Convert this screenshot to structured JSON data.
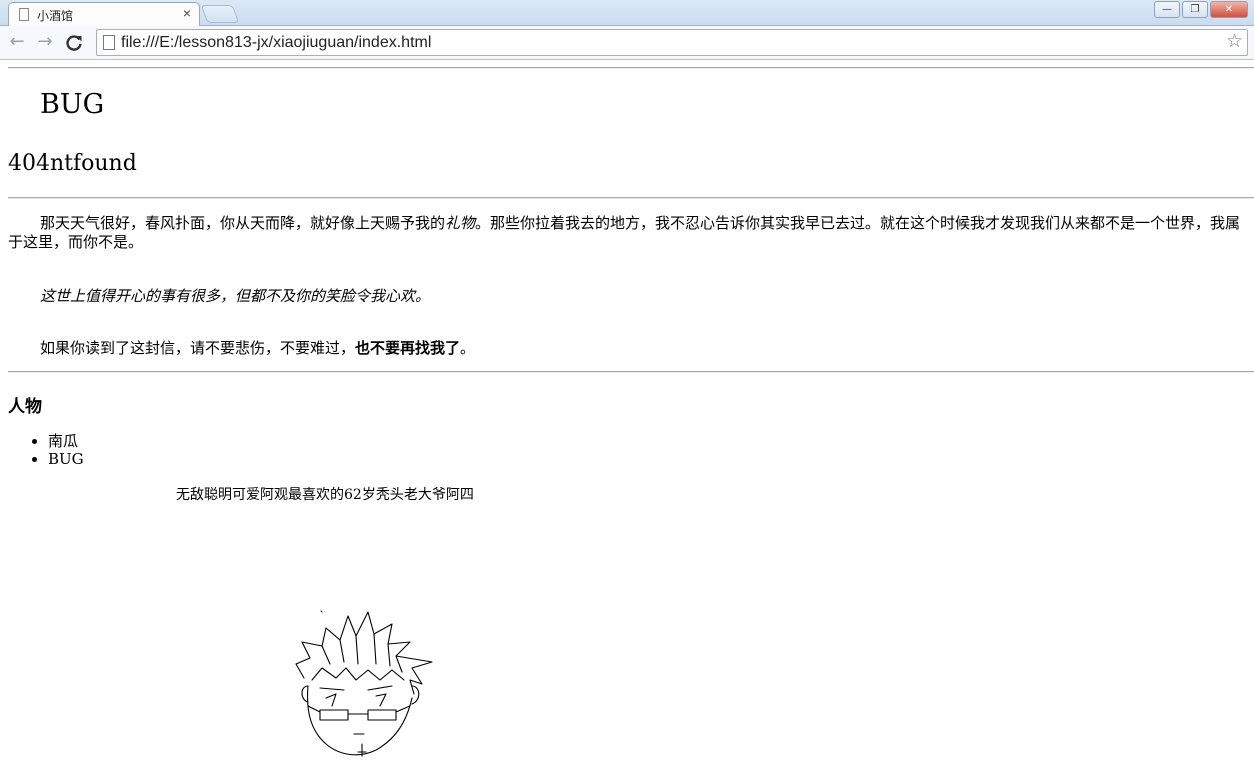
{
  "browser": {
    "tab_title": "小酒馆",
    "tab_close": "×",
    "url": "file:///E:/lesson813-jx/xiaojiuguan/index.html",
    "back": "←",
    "forward": "→",
    "reload": "C",
    "bookmark_star": "☆",
    "window_buttons": {
      "minimize": "—",
      "restore": "❐",
      "close": "✕"
    }
  },
  "page": {
    "h1": "BUG",
    "h2": "404ntfound",
    "paragraph": {
      "before_em": "那天天气很好，春风扑面，你从天而降，就好像上天赐予我的",
      "em": "礼物",
      "after_em": "。那些你拉着我去的地方，我不忍心告诉你其实我早已去过。就在这个时候我才发现我们从来都不是一个世界，我属于这里，而你不是。"
    },
    "quote": "这世上值得开心的事有很多，但都不及你的笑脸令我心欢。",
    "letter": {
      "before_bold": "如果你读到了这封信，请不要悲伤，不要难过，",
      "bold": "也不要再找我了",
      "after_bold": "。"
    },
    "people_heading": "人物",
    "people": [
      "南瓜",
      "BUG"
    ],
    "caption": "无敌聪明可爱阿观最喜欢的62岁秃头老大爷阿四",
    "image_subject": "hand-drawn-spiky-hair-glasses-face"
  }
}
